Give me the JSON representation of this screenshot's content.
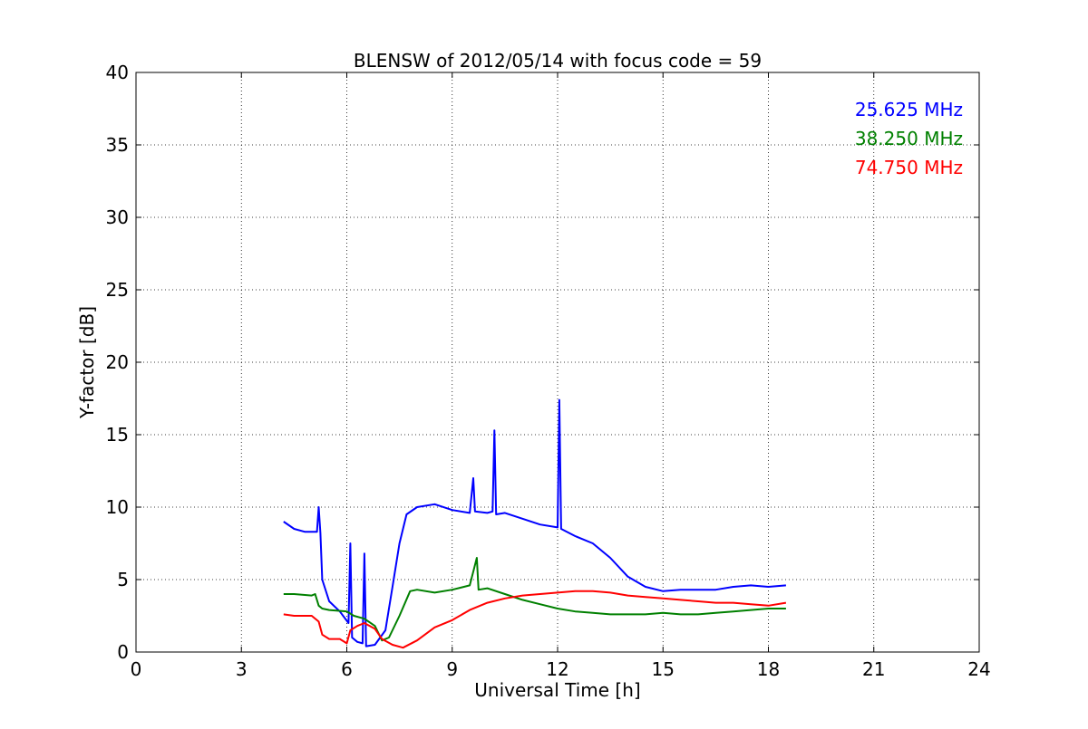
{
  "chart_data": {
    "type": "line",
    "title": "BLENSW of 2012/05/14 with focus code = 59",
    "xlabel": "Universal Time [h]",
    "ylabel": "Y-factor [dB]",
    "xlim": [
      0,
      24
    ],
    "ylim": [
      0,
      40
    ],
    "xticks": [
      "0",
      "3",
      "6",
      "9",
      "12",
      "15",
      "18",
      "21",
      "24"
    ],
    "yticks": [
      "0",
      "5",
      "10",
      "15",
      "20",
      "25",
      "30",
      "35",
      "40"
    ],
    "grid": true,
    "legend_position": "top-right",
    "series": [
      {
        "name": "25.625 MHz",
        "color": "#0000ff",
        "x": [
          4.2,
          4.5,
          4.8,
          5.0,
          5.15,
          5.2,
          5.25,
          5.3,
          5.5,
          5.8,
          6.05,
          6.1,
          6.15,
          6.3,
          6.45,
          6.5,
          6.55,
          6.8,
          7.1,
          7.3,
          7.5,
          7.7,
          8.0,
          8.5,
          9.0,
          9.5,
          9.6,
          9.65,
          10.0,
          10.15,
          10.2,
          10.25,
          10.5,
          11.0,
          11.5,
          12.0,
          12.05,
          12.1,
          12.5,
          13.0,
          13.5,
          14.0,
          14.5,
          15.0,
          15.5,
          16.0,
          16.5,
          17.0,
          17.5,
          18.0,
          18.5
        ],
        "y": [
          9.0,
          8.5,
          8.3,
          8.3,
          8.3,
          10.0,
          8.2,
          5.0,
          3.5,
          2.8,
          2.0,
          7.5,
          1.0,
          0.7,
          0.6,
          6.8,
          0.4,
          0.5,
          1.5,
          4.5,
          7.5,
          9.5,
          10.0,
          10.2,
          9.8,
          9.6,
          12.0,
          9.7,
          9.6,
          9.7,
          15.3,
          9.5,
          9.6,
          9.2,
          8.8,
          8.6,
          17.4,
          8.5,
          8.0,
          7.5,
          6.5,
          5.2,
          4.5,
          4.2,
          4.3,
          4.3,
          4.3,
          4.5,
          4.6,
          4.5,
          4.6
        ]
      },
      {
        "name": "38.250 MHz",
        "color": "#008000",
        "x": [
          4.2,
          4.5,
          5.0,
          5.1,
          5.2,
          5.3,
          5.5,
          6.0,
          6.2,
          6.5,
          6.8,
          7.0,
          7.2,
          7.5,
          7.8,
          8.0,
          8.5,
          9.0,
          9.5,
          9.7,
          9.75,
          10.0,
          10.5,
          11.0,
          11.5,
          12.0,
          12.5,
          13.0,
          13.5,
          14.0,
          14.5,
          15.0,
          15.5,
          16.0,
          16.5,
          17.0,
          17.5,
          18.0,
          18.5
        ],
        "y": [
          4.0,
          4.0,
          3.9,
          4.0,
          3.2,
          3.0,
          2.9,
          2.8,
          2.5,
          2.3,
          1.8,
          0.8,
          1.0,
          2.5,
          4.2,
          4.3,
          4.1,
          4.3,
          4.6,
          6.5,
          4.3,
          4.4,
          4.0,
          3.6,
          3.3,
          3.0,
          2.8,
          2.7,
          2.6,
          2.6,
          2.6,
          2.7,
          2.6,
          2.6,
          2.7,
          2.8,
          2.9,
          3.0,
          3.0
        ]
      },
      {
        "name": "74.750 MHz",
        "color": "#ff0000",
        "x": [
          4.2,
          4.5,
          5.0,
          5.2,
          5.3,
          5.5,
          5.8,
          6.0,
          6.1,
          6.3,
          6.5,
          6.8,
          7.0,
          7.3,
          7.6,
          8.0,
          8.5,
          9.0,
          9.5,
          10.0,
          10.5,
          11.0,
          11.5,
          12.0,
          12.5,
          13.0,
          13.5,
          14.0,
          14.5,
          15.0,
          15.5,
          16.0,
          16.5,
          17.0,
          17.5,
          18.0,
          18.5
        ],
        "y": [
          2.6,
          2.5,
          2.5,
          2.1,
          1.2,
          0.9,
          0.9,
          0.6,
          1.5,
          1.8,
          2.0,
          1.6,
          0.9,
          0.5,
          0.3,
          0.8,
          1.7,
          2.2,
          2.9,
          3.4,
          3.7,
          3.9,
          4.0,
          4.1,
          4.2,
          4.2,
          4.1,
          3.9,
          3.8,
          3.7,
          3.6,
          3.5,
          3.4,
          3.4,
          3.3,
          3.2,
          3.4
        ]
      }
    ]
  }
}
